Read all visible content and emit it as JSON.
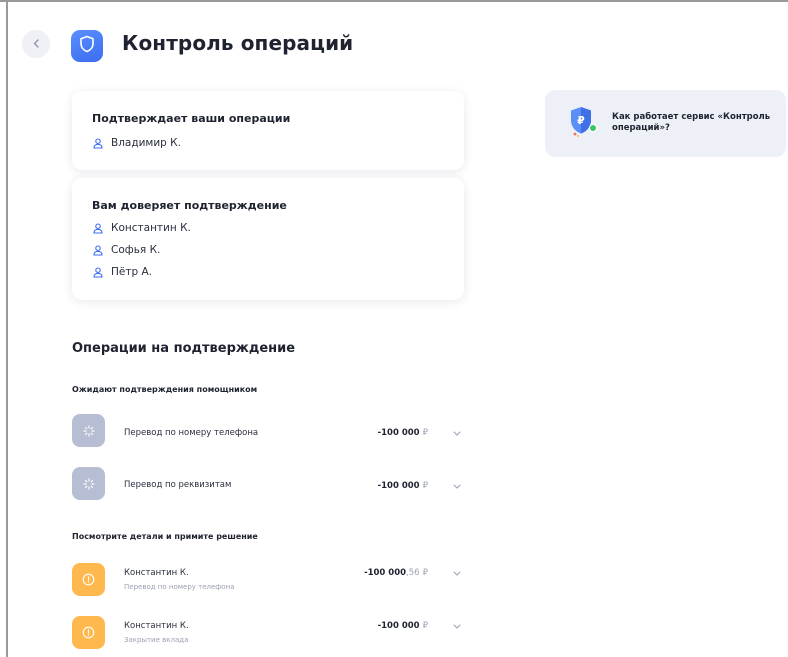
{
  "header": {
    "back_icon": "chevron-left-icon",
    "logo_icon": "shield-icon",
    "title": "Контроль операций"
  },
  "confirmers_card": {
    "title": "Подтверждает ваши операции",
    "people": [
      "Владимир К."
    ]
  },
  "trusted_card": {
    "title": "Вам доверяет подтверждение",
    "people": [
      "Константин К.",
      "Софья К.",
      "Пётр А."
    ]
  },
  "info_card": {
    "text": "Как работает сервис «Контроль операций»?",
    "icon": "shield-ruble-icon"
  },
  "operations": {
    "title": "Операции на подтверждение",
    "waiting": {
      "title": "Ожидают  подтверждения помощником",
      "items": [
        {
          "name": "Перевод по номеру телефона",
          "amount": "-100 000",
          "currency": "₽"
        },
        {
          "name": "Перевод по реквизитам",
          "amount": "-100 000",
          "currency": "₽"
        }
      ]
    },
    "decide": {
      "title": "Посмотрите детали и примите решение",
      "items": [
        {
          "name": "Константин К.",
          "sub": "Перевод по номеру телефона",
          "amount": "-100 000",
          "cents": ",56",
          "currency": "₽"
        },
        {
          "name": "Константин К.",
          "sub": "Закрытие вклада",
          "amount": "-100 000",
          "cents": "",
          "currency": "₽"
        }
      ]
    }
  },
  "colors": {
    "accent": "#3b6df0",
    "pending_icon": "#b7bdd2",
    "warning_icon": "#ffb84d",
    "info_bg": "#eef0f8"
  }
}
